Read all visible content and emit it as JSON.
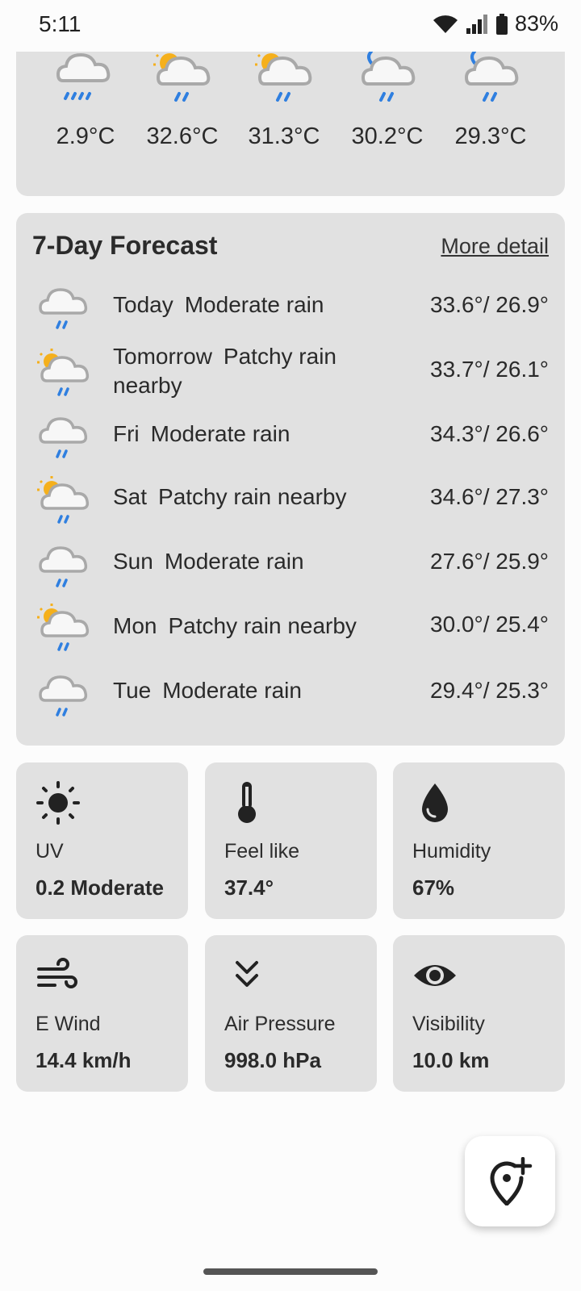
{
  "status": {
    "time": "5:11",
    "battery": "83%"
  },
  "hourly": [
    {
      "temp": "2.9°C",
      "icon": "cloud-rain-icon"
    },
    {
      "temp": "32.6°C",
      "icon": "sun-cloud-rain-icon"
    },
    {
      "temp": "31.3°C",
      "icon": "sun-cloud-rain-icon"
    },
    {
      "temp": "30.2°C",
      "icon": "moon-cloud-rain-icon"
    },
    {
      "temp": "29.3°C",
      "icon": "moon-cloud-rain-icon"
    }
  ],
  "forecast": {
    "title": "7-Day Forecast",
    "more": "More detail",
    "days": [
      {
        "day": "Today",
        "cond": "Moderate rain",
        "temps": "33.6°/ 26.9°",
        "icon": "cloud-rain-icon"
      },
      {
        "day": "Tomorrow",
        "cond": "Patchy rain nearby",
        "temps": "33.7°/ 26.1°",
        "icon": "sun-cloud-rain-icon"
      },
      {
        "day": "Fri",
        "cond": "Moderate rain",
        "temps": "34.3°/ 26.6°",
        "icon": "cloud-rain-icon"
      },
      {
        "day": "Sat",
        "cond": "Patchy rain nearby",
        "temps": "34.6°/ 27.3°",
        "icon": "sun-cloud-rain-icon"
      },
      {
        "day": "Sun",
        "cond": "Moderate rain",
        "temps": "27.6°/ 25.9°",
        "icon": "cloud-rain-icon"
      },
      {
        "day": "Mon",
        "cond": "Patchy rain nearby",
        "temps": "30.0°/ 25.4°",
        "icon": "sun-cloud-rain-icon"
      },
      {
        "day": "Tue",
        "cond": "Moderate rain",
        "temps": "29.4°/ 25.3°",
        "icon": "cloud-rain-icon"
      }
    ]
  },
  "tiles": {
    "uv": {
      "label": "UV",
      "value": "0.2 Moderate",
      "icon": "sun-icon"
    },
    "feel": {
      "label": "Feel like",
      "value": "37.4°",
      "icon": "thermometer-icon"
    },
    "humidity": {
      "label": "Humidity",
      "value": "67%",
      "icon": "water-drop-icon"
    },
    "wind": {
      "label": "E Wind",
      "value": "14.4 km/h",
      "icon": "wind-icon"
    },
    "pressure": {
      "label": "Air Pressure",
      "value": "998.0 hPa",
      "icon": "double-chevron-down-icon"
    },
    "visibility": {
      "label": "Visibility",
      "value": "10.0 km",
      "icon": "eye-icon"
    }
  },
  "colors": {
    "card": "#e1e1e1",
    "rain": "#2f7fe0",
    "sun": "#f5b01c",
    "cloud": "#a9a9a9"
  }
}
